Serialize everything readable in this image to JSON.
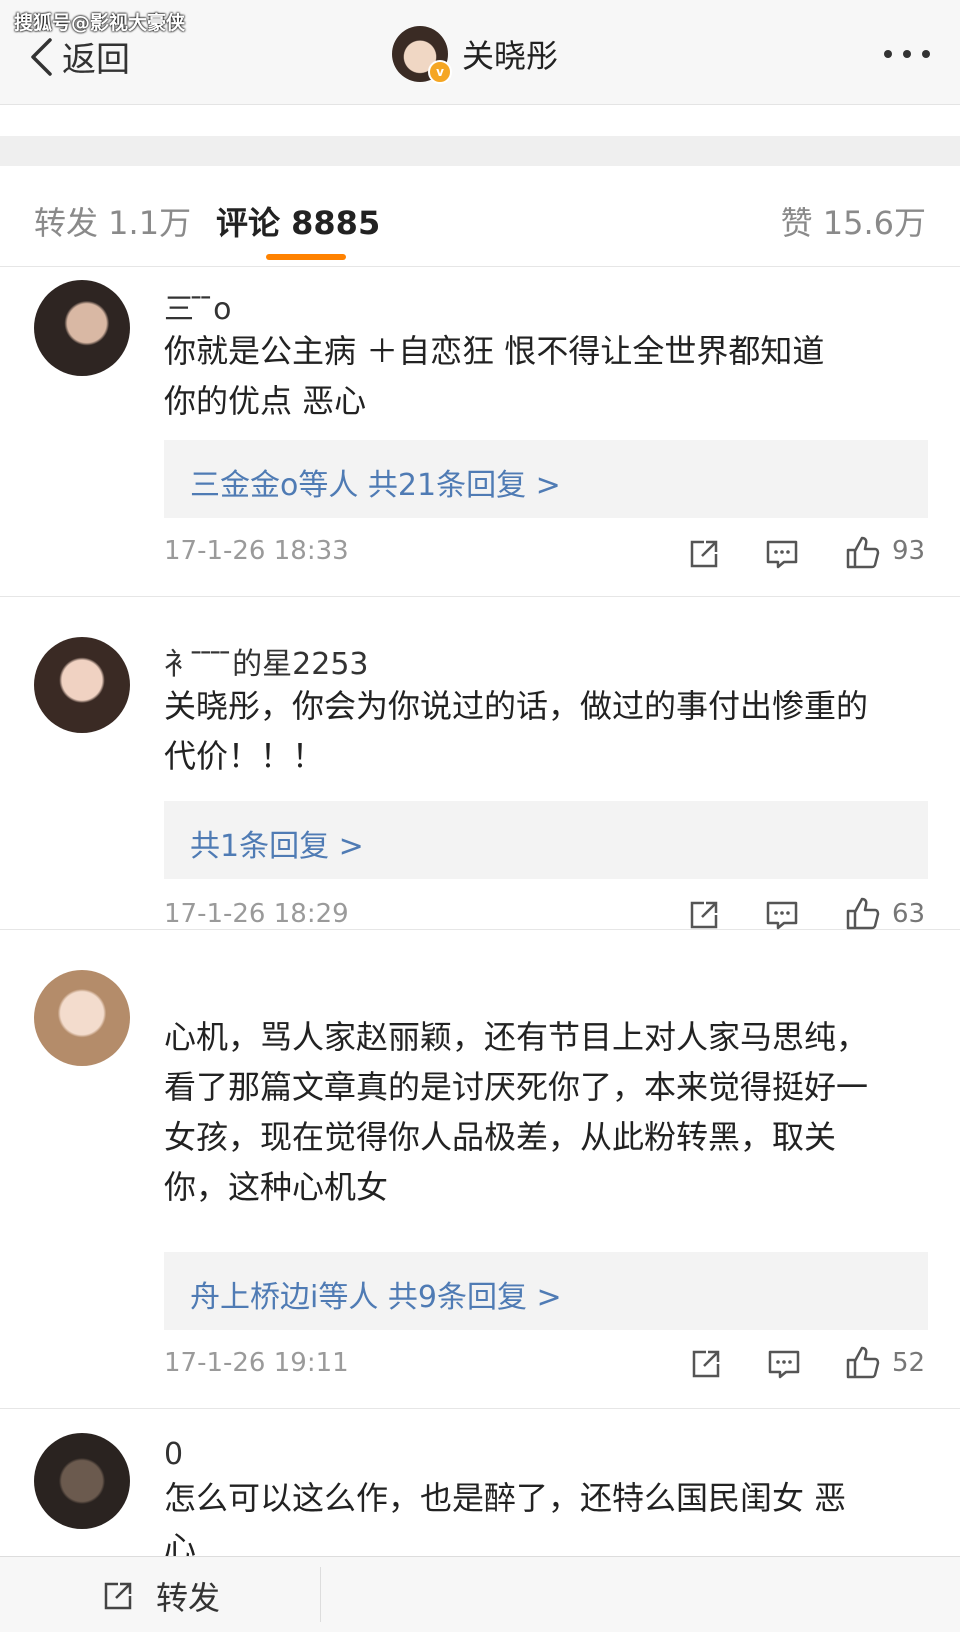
{
  "watermark": "搜狐号@影视大豪侠",
  "navbar": {
    "back_label": "返回",
    "title": "关晓彤"
  },
  "tabs": {
    "repost": "转发 1.1万",
    "comment": "评论 8885",
    "like": "赞 15.6万"
  },
  "colors": {
    "accent": "#ff8200",
    "link": "#4f7bb4",
    "verified_badge": "#f5a623"
  },
  "comments": [
    {
      "username": "三 ̄ ̄o",
      "text_lines": [
        "你就是公主病 ＋自恋狂 恨不得让全世界都知道",
        "你的优点 恶心"
      ],
      "reply_summary": "三金金o等人 共21条回复 >",
      "time": "17-1-26 18:33",
      "likes": "93"
    },
    {
      "username": "衤 ̄ ̄ ̄ ̄的星2253",
      "text_lines": [
        "关晓彤，你会为你说过的话，做过的事付出惨重的",
        "代价！！！"
      ],
      "reply_summary": "共1条回复 >",
      "time": "17-1-26 18:29",
      "likes": "63"
    },
    {
      "username": "",
      "text_lines": [
        "心机，骂人家赵丽颖，还有节目上对人家马思纯，",
        "看了那篇文章真的是讨厌死你了，本来觉得挺好一",
        "女孩，现在觉得你人品极差，从此粉转黑，取关",
        "你，这种心机女"
      ],
      "reply_summary": "舟上桥边i等人 共9条回复 >",
      "time": "17-1-26 19:11",
      "likes": "52"
    },
    {
      "username": "0",
      "text_lines": [
        "怎么可以这么作，也是醉了，还特么国民闺女 恶",
        "心"
      ]
    }
  ],
  "bottom_bar": {
    "repost_label": "转发"
  },
  "icons": [
    "chevron-left-icon",
    "more-dots-icon",
    "repost-icon",
    "comment-icon",
    "thumbs-up-icon",
    "verified-badge-icon"
  ]
}
